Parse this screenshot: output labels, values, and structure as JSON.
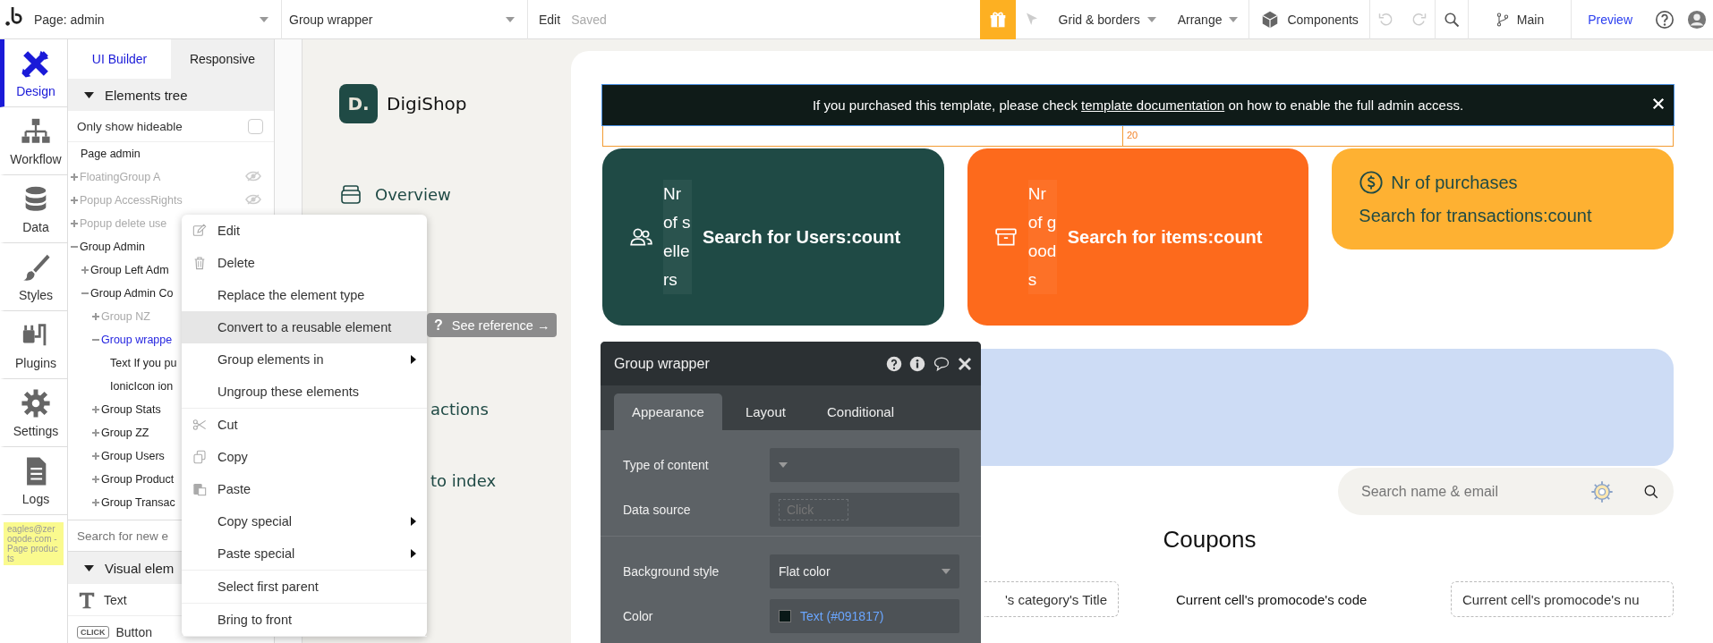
{
  "topbar": {
    "page": "Page: admin",
    "element": "Group wrapper",
    "edit": "Edit",
    "status": "Saved",
    "grid": "Grid & borders",
    "arrange": "Arrange",
    "components": "Components",
    "branch": "Main",
    "preview": "Preview"
  },
  "rail": [
    {
      "label": "Design",
      "selected": true
    },
    {
      "label": "Workflow",
      "selected": false
    },
    {
      "label": "Data",
      "selected": false
    },
    {
      "label": "Styles",
      "selected": false
    },
    {
      "label": "Plugins",
      "selected": false
    },
    {
      "label": "Settings",
      "selected": false
    },
    {
      "label": "Logs",
      "selected": false
    }
  ],
  "note": "eagles@zeroqode.com - Page products",
  "panel_tabs": [
    {
      "label": "UI Builder",
      "selected": true
    },
    {
      "label": "Responsive",
      "selected": false
    }
  ],
  "tree_header": {
    "label": "Elements tree",
    "expanded": true
  },
  "hideable": {
    "label": "Only show hideable",
    "checked": false
  },
  "tree": {
    "label": "Page admin",
    "selected": false,
    "children": [
      {
        "kind": "group",
        "label": "FloatingGroup A",
        "expanded": false,
        "hidden": true,
        "visibility_icon": true,
        "selected": false
      },
      {
        "kind": "group",
        "label": "Popup AccessRights",
        "expanded": false,
        "hidden": true,
        "visibility_icon": true,
        "selected": false
      },
      {
        "kind": "group",
        "label": "Popup delete use",
        "expanded": false,
        "hidden": true,
        "selected": false
      },
      {
        "kind": "group",
        "label": "Group Admin",
        "expanded": true,
        "hidden": false,
        "selected": false,
        "children": [
          {
            "kind": "group",
            "label": "Group Left Adm",
            "expanded": false,
            "hidden": false,
            "selected": false
          },
          {
            "kind": "group",
            "label": "Group Admin Co",
            "expanded": true,
            "hidden": false,
            "selected": false,
            "children": [
              {
                "kind": "group",
                "label": "Group NZ",
                "expanded": false,
                "hidden": true,
                "selected": false
              },
              {
                "kind": "group",
                "label": "Group wrappe",
                "expanded": true,
                "hidden": false,
                "selected": true,
                "children": [
                  {
                    "kind": "leaf",
                    "label": "Text If you pu",
                    "hidden": false,
                    "selected": false
                  },
                  {
                    "kind": "leaf",
                    "label": "IonicIcon ion",
                    "hidden": false,
                    "selected": false
                  }
                ]
              },
              {
                "kind": "group",
                "label": "Group Stats",
                "expanded": false,
                "hidden": false,
                "selected": false
              },
              {
                "kind": "group",
                "label": "Group ZZ",
                "expanded": false,
                "hidden": false,
                "selected": false
              },
              {
                "kind": "group",
                "label": "Group Users",
                "expanded": false,
                "hidden": false,
                "selected": false
              },
              {
                "kind": "group",
                "label": "Group Product",
                "expanded": false,
                "hidden": false,
                "selected": false
              },
              {
                "kind": "group",
                "label": "Group Transac",
                "expanded": false,
                "hidden": false,
                "selected": false
              }
            ]
          }
        ]
      }
    ]
  },
  "element_search": {
    "placeholder": "Search for new e"
  },
  "visual_header": {
    "label": "Visual elem",
    "expanded": true
  },
  "visual_elements": [
    {
      "kind": "text",
      "label": "Text"
    },
    {
      "kind": "button",
      "label": "Button",
      "icon_text": "CLICK"
    }
  ],
  "context_menu": {
    "sections": [
      [
        {
          "kind": "edit",
          "label": "Edit",
          "selected": false,
          "has_submenu": false
        },
        {
          "kind": "delete",
          "label": "Delete",
          "selected": false,
          "has_submenu": false
        },
        {
          "kind": "plain",
          "label": "Replace the element type",
          "selected": false,
          "has_submenu": false
        },
        {
          "kind": "plain",
          "label": "Convert to a reusable element",
          "selected": true,
          "has_submenu": false
        },
        {
          "kind": "plain",
          "label": "Group elements in",
          "selected": false,
          "has_submenu": true
        },
        {
          "kind": "plain",
          "label": "Ungroup these elements",
          "selected": false,
          "has_submenu": false
        }
      ],
      [
        {
          "kind": "cut",
          "label": "Cut",
          "selected": false,
          "has_submenu": false
        },
        {
          "kind": "copy",
          "label": "Copy",
          "selected": false,
          "has_submenu": false
        },
        {
          "kind": "paste",
          "label": "Paste",
          "selected": false,
          "has_submenu": false
        },
        {
          "kind": "plain",
          "label": "Copy special",
          "selected": false,
          "has_submenu": true
        },
        {
          "kind": "plain",
          "label": "Paste special",
          "selected": false,
          "has_submenu": true
        }
      ],
      [
        {
          "kind": "plain",
          "label": "Select first parent",
          "selected": false,
          "has_submenu": false
        }
      ],
      [
        {
          "kind": "plain",
          "label": "Bring to front",
          "selected": false,
          "has_submenu": false
        }
      ]
    ]
  },
  "tooltip": {
    "icon": "?",
    "label": "See reference →"
  },
  "brand": {
    "logo": "D.",
    "name": "DigiShop"
  },
  "nav": [
    {
      "kind": "full",
      "label": "Overview"
    },
    {
      "kind": "partial",
      "label": "actions"
    },
    {
      "kind": "partial",
      "label": "to index"
    }
  ],
  "banner": {
    "text_before": "If you purchased this template, please check ",
    "link": "template documentation",
    "text_after": " on how to enable the full admin access."
  },
  "spacing": "20",
  "cards": [
    {
      "kind": "vertical",
      "label": "Nr of sellers",
      "value": "Search for Users:count",
      "color": "#1f4a45"
    },
    {
      "kind": "vertical",
      "label": "Nr of goods",
      "value": "Search for items:count",
      "color": "#fd6a1c"
    },
    {
      "kind": "horizontal",
      "label": "Nr of purchases",
      "value": "Search for transactions:count",
      "color": "#feb132"
    }
  ],
  "search": {
    "placeholder": "Search name & email"
  },
  "coupons_title": "Coupons",
  "bottom_row": [
    {
      "kind": "dashed",
      "text": "'s category's Title"
    },
    {
      "kind": "plain",
      "text": "Current cell's promocode's code"
    },
    {
      "kind": "dashed",
      "text": "Current cell's promocode's nu"
    }
  ],
  "property_panel": {
    "title": "Group wrapper",
    "tabs": [
      {
        "label": "Appearance",
        "selected": true
      },
      {
        "label": "Layout",
        "selected": false
      },
      {
        "label": "Conditional",
        "selected": false
      }
    ],
    "sections": [
      [
        {
          "kind": "dropdown",
          "label": "Type of content"
        },
        {
          "kind": "input",
          "label": "Data source",
          "placeholder": "Click"
        }
      ],
      [
        {
          "kind": "dropdown",
          "label": "Background style",
          "value": "Flat color"
        },
        {
          "kind": "color",
          "label": "Color",
          "value": "Text (#091817)",
          "color": "#091817"
        }
      ]
    ]
  }
}
